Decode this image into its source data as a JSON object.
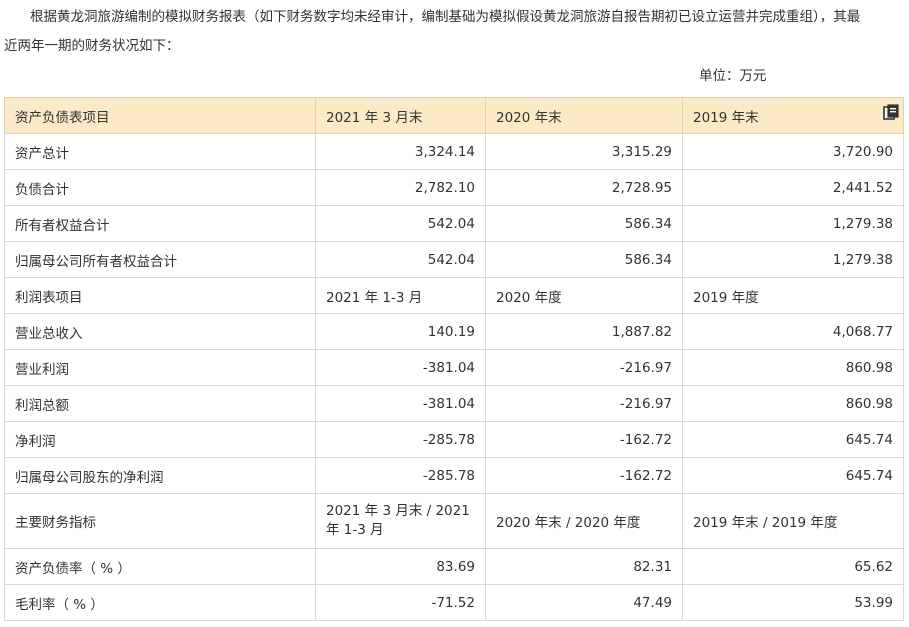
{
  "intro": {
    "line1": "根据黄龙洞旅游编制的模拟财务报表（如下财务数字均未经审计，编制基础为模拟假设黄龙洞旅游自报告期初已设立运营并完成重组），其最",
    "line2": "近两年一期的财务状况如下："
  },
  "unit_label": "单位：万元",
  "table": {
    "header": [
      "资产负债表项目",
      "2021 年 3 月末",
      "2020 年末",
      "2019 年末"
    ],
    "balance_rows": [
      [
        "资产总计",
        "3,324.14",
        "3,315.29",
        "3,720.90"
      ],
      [
        "负债合计",
        "2,782.10",
        "2,728.95",
        "2,441.52"
      ],
      [
        "所有者权益合计",
        "542.04",
        "586.34",
        "1,279.38"
      ],
      [
        "归属母公司所有者权益合计",
        "542.04",
        "586.34",
        "1,279.38"
      ]
    ],
    "income_header": [
      "利润表项目",
      "2021 年 1-3 月",
      "2020 年度",
      "2019 年度"
    ],
    "income_rows": [
      [
        "营业总收入",
        "140.19",
        "1,887.82",
        "4,068.77"
      ],
      [
        "营业利润",
        "-381.04",
        "-216.97",
        "860.98"
      ],
      [
        "利润总额",
        "-381.04",
        "-216.97",
        "860.98"
      ],
      [
        "净利润",
        "-285.78",
        "-162.72",
        "645.74"
      ],
      [
        "归属母公司股东的净利润",
        "-285.78",
        "-162.72",
        "645.74"
      ]
    ],
    "ratio_header": [
      "主要财务指标",
      "2021 年 3 月末 / 2021 年 1-3 月",
      "2020 年末 / 2020 年度",
      "2019 年末 / 2019 年度"
    ],
    "ratio_rows": [
      [
        "资产负债率（ % ）",
        "83.69",
        "82.31",
        "65.62"
      ],
      [
        "毛利率（ % ）",
        "-71.52",
        "47.49",
        "53.99"
      ]
    ]
  },
  "icons": {
    "copy": "copy-icon"
  }
}
